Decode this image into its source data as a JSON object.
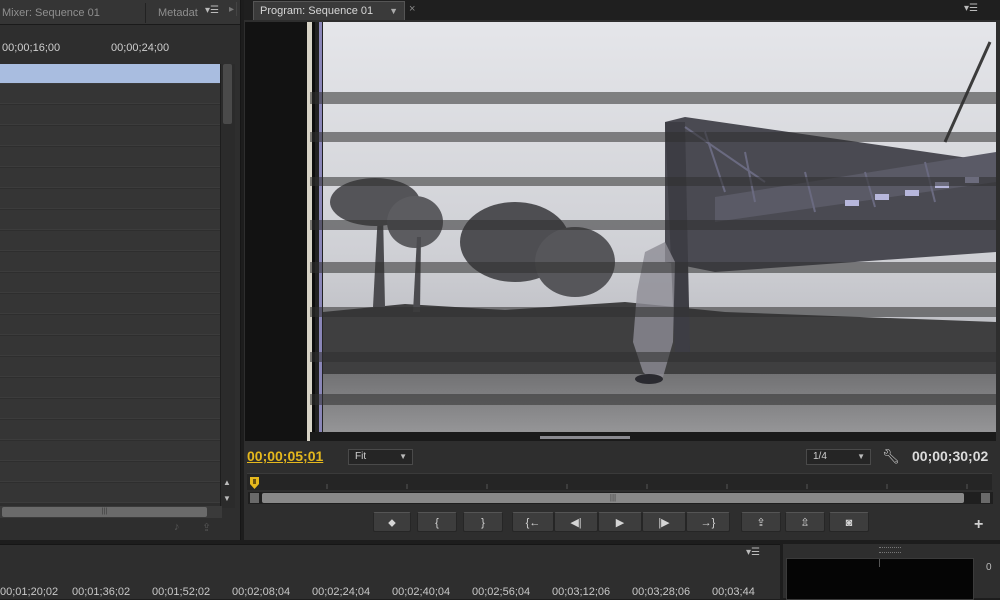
{
  "left_panel": {
    "tabs": [
      {
        "label": "Mixer: Sequence 01"
      },
      {
        "label": "Metadat"
      }
    ],
    "ruler_ticks": [
      "00;00;16;00",
      "00;00;24;00"
    ],
    "hscroll_grip": "|||"
  },
  "program_monitor": {
    "tab_label": "Program: Sequence 01",
    "close_glyph": "×",
    "current_timecode": "00;00;05;01",
    "zoom_dropdown": "Fit",
    "resolution_dropdown": "1/4",
    "duration_timecode": "00;00;30;02",
    "zoom_grip": "|||",
    "transport_buttons": [
      {
        "name": "add-marker-button",
        "glyph": "⬥"
      },
      {
        "name": "mark-in-button",
        "glyph": "{"
      },
      {
        "name": "mark-out-button",
        "glyph": "}"
      },
      {
        "name": "go-to-in-button",
        "glyph": "{←"
      },
      {
        "name": "step-back-button",
        "glyph": "◀|"
      },
      {
        "name": "play-button",
        "glyph": "▶"
      },
      {
        "name": "step-forward-button",
        "glyph": "|▶"
      },
      {
        "name": "go-to-out-button",
        "glyph": "→}"
      },
      {
        "name": "lift-button",
        "glyph": "⇪"
      },
      {
        "name": "extract-button",
        "glyph": "⇫"
      },
      {
        "name": "export-frame-button",
        "glyph": "◙"
      }
    ],
    "add_button": "+"
  },
  "timeline": {
    "ruler_ticks": [
      "00;01;20;02",
      "00;01;36;02",
      "00;01;52;02",
      "00;02;08;04",
      "00;02;24;04",
      "00;02;40;04",
      "00;02;56;04",
      "00;03;12;06",
      "00;03;28;06",
      "00;03;44"
    ]
  },
  "audio_meter": {
    "zero_label": "0"
  },
  "icons": {
    "panel_menu": "▾☰"
  },
  "colors": {
    "accent_timecode": "#e5b81d",
    "selection": "#a9bde0",
    "panel_bg": "#2e2e2e"
  }
}
